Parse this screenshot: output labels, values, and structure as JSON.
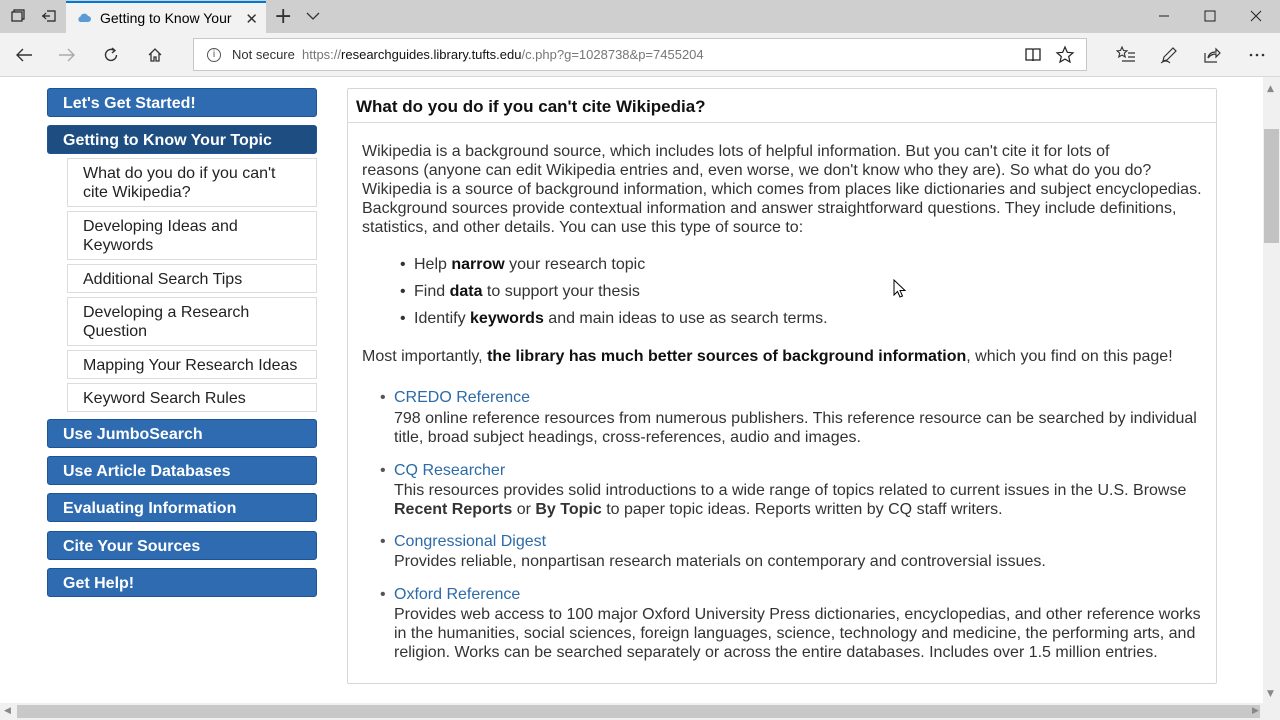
{
  "browser": {
    "tab_title": "Getting to Know Your To",
    "address": {
      "security": "Not secure",
      "url_scheme": "https://",
      "url_host": "researchguides.library.tufts.edu",
      "url_path": "/c.php?g=1028738&p=7455204"
    }
  },
  "sidebar": {
    "items": [
      {
        "label": "Let's Get Started!"
      },
      {
        "label": "Getting to Know Your Topic"
      },
      {
        "label": "Use JumboSearch"
      },
      {
        "label": "Use Article Databases"
      },
      {
        "label": "Evaluating Information"
      },
      {
        "label": "Cite Your Sources"
      },
      {
        "label": "Get Help!"
      }
    ],
    "subitems": [
      {
        "line1": "What do you do if you can't",
        "line2": "cite Wikipedia?"
      },
      {
        "line1": "Developing Ideas and",
        "line2": "Keywords"
      },
      {
        "line1": "Additional Search Tips",
        "line2": ""
      },
      {
        "line1": "Developing a Research",
        "line2": "Question"
      },
      {
        "line1": "Mapping Your Research Ideas",
        "line2": ""
      },
      {
        "line1": "Keyword Search Rules",
        "line2": ""
      }
    ]
  },
  "main": {
    "title": "What do you do if you can't cite Wikipedia?",
    "intro_lines": [
      "Wikipedia is a background source, which includes lots of helpful information. But you can't cite it for lots of",
      "reasons (anyone can edit Wikipedia entries and, even worse, we don't know who they are). So what do you do?",
      "Wikipedia is a source of background information, which comes from places like dictionaries and subject encyclopedias.",
      "Background sources provide contextual information and answer straightforward questions. They include definitions,",
      "statistics, and other details. You can use this type of source to:"
    ],
    "bullets": [
      {
        "pre": "Help ",
        "bold": "narrow",
        "post": " your research topic"
      },
      {
        "pre": "Find ",
        "bold": "data",
        "post": " to support your thesis"
      },
      {
        "pre": "Identify ",
        "bold": "keywords",
        "post": " and main ideas to use as search terms."
      }
    ],
    "important": {
      "pre": "Most importantly, ",
      "bold": "the library has much better sources of background information",
      "post": ", which you find on this page!"
    },
    "resources": [
      {
        "name": "CREDO Reference",
        "desc": [
          "798 online reference resources from numerous publishers. This reference resource can be searched by individual",
          "title, broad subject headings, cross-references, audio and images."
        ]
      },
      {
        "name": "CQ Researcher",
        "desc_pre": "This resources provides solid introductions to a wide range of topics related to current issues in the U.S. Browse",
        "desc_b1": "Recent Reports",
        "desc_mid": " or ",
        "desc_b2": "By Topic",
        "desc_post": " to paper topic ideas. Reports written by CQ staff writers."
      },
      {
        "name": "Congressional Digest",
        "desc": [
          "Provides reliable, nonpartisan research materials on contemporary and controversial issues."
        ]
      },
      {
        "name": "Oxford Reference",
        "desc": [
          "Provides web access to 100 major Oxford University Press dictionaries, encyclopedias, and other reference works",
          "in the humanities, social sciences, foreign languages, science, technology and medicine, the performing arts, and",
          "religion. Works can be searched separately or across the entire databases. Includes over 1.5 million entries."
        ]
      }
    ]
  },
  "colors": {
    "nav_button": "#2e6bb0",
    "nav_button_active": "#1e4d82",
    "link": "#2c6aa8",
    "tab_accent": "#0078d7"
  }
}
